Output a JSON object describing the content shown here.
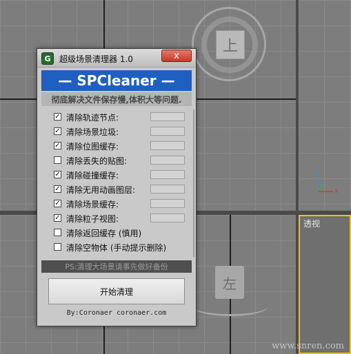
{
  "viewport": {
    "perspective_label": "透视",
    "cube_top_label": "上",
    "cube_bottom_label": "左",
    "axis_z": "z",
    "axis_x": "x",
    "watermark": "www.snren.com"
  },
  "dialog": {
    "title": "超级场景清理器 1.0",
    "close_label": "x",
    "banner": "— SPCleaner —",
    "subtitle": "彻底解决文件保存慢,体积大等问题.",
    "options": [
      {
        "label": "清除轨迹节点:",
        "checked": true
      },
      {
        "label": "清除场景垃圾:",
        "checked": true
      },
      {
        "label": "清除位图缓存:",
        "checked": true
      },
      {
        "label": "清除丢失的贴图:",
        "checked": false
      },
      {
        "label": "清除碰撞缓存:",
        "checked": true
      },
      {
        "label": "清除无用动画图层:",
        "checked": true
      },
      {
        "label": "清除场景缓存:",
        "checked": true
      },
      {
        "label": "清除粒子视图:",
        "checked": true
      },
      {
        "label": "清除返回缓存 (慎用)",
        "checked": false
      },
      {
        "label": "清除空物体 (手动提示删除)",
        "checked": false
      }
    ],
    "ps_note": "PS:清理大场景请事先做好备份",
    "start_button": "开始清理",
    "footer": "By:Coronaer   coronaer.com",
    "colors": {
      "banner": "#1f5fc0",
      "close": "#c23b26"
    }
  }
}
